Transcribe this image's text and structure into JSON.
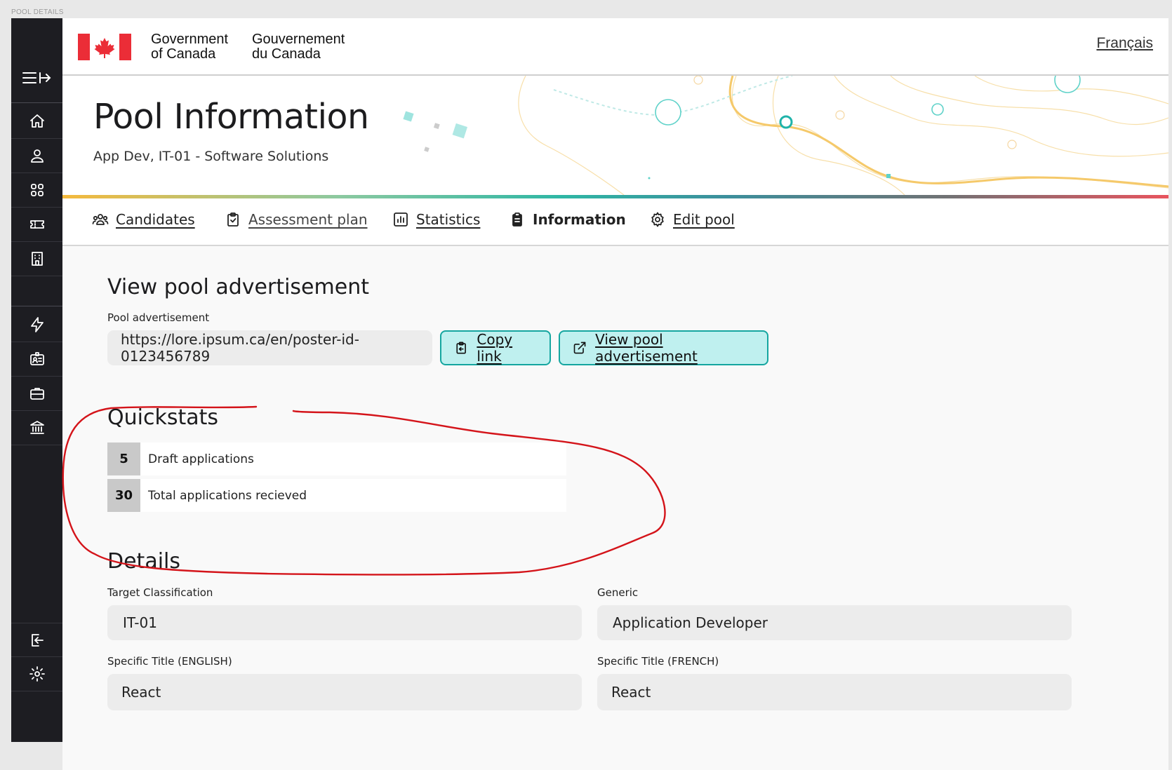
{
  "frame_label": "POOL DETAILS",
  "header": {
    "signature_en_line1": "Government",
    "signature_en_line2": "of Canada",
    "signature_fr_line1": "Gouvernement",
    "signature_fr_line2": "du Canada",
    "language_toggle": "Français"
  },
  "hero": {
    "title": "Pool Information",
    "subtitle": "App Dev, IT-01 - Software Solutions"
  },
  "tabs": [
    {
      "label": "Candidates",
      "icon": "users-icon",
      "active": false
    },
    {
      "label": "Assessment plan",
      "icon": "clipboard-check-icon",
      "active": false
    },
    {
      "label": "Statistics",
      "icon": "bar-chart-icon",
      "active": false
    },
    {
      "label": "Information",
      "icon": "clipboard-icon",
      "active": true
    },
    {
      "label": "Edit pool",
      "icon": "gear-icon",
      "active": false
    }
  ],
  "sidebar": {
    "items": [
      "home-icon",
      "user-icon",
      "dashboard-icon",
      "ticket-icon",
      "building-icon",
      "lightning-icon",
      "id-card-icon",
      "briefcase-icon",
      "bank-icon",
      "logout-icon",
      "gear-icon"
    ]
  },
  "advertisement": {
    "section_title": "View pool advertisement",
    "field_label": "Pool advertisement",
    "url": "https://lore.ipsum.ca/en/poster-id-0123456789",
    "copy_button": "Copy link",
    "view_button": "View pool advertisement"
  },
  "quickstats": {
    "section_title": "Quickstats",
    "items": [
      {
        "count": "5",
        "label": "Draft applications"
      },
      {
        "count": "30",
        "label": "Total applications recieved"
      }
    ],
    "annotation_color": "#d4141a"
  },
  "details": {
    "section_title": "Details",
    "fields": [
      {
        "label": "Target Classification",
        "value": "IT-01"
      },
      {
        "label": "Generic",
        "value": "Application Developer"
      },
      {
        "label": "Specific Title (ENGLISH)",
        "value": "React"
      },
      {
        "label": "Specific Title (FRENCH)",
        "value": "React"
      }
    ]
  },
  "colors": {
    "accent_teal": "#15a6a0",
    "button_bg": "#bff0ef",
    "sidebar_bg": "#1d1d22",
    "flag_red": "#eb2d37"
  }
}
